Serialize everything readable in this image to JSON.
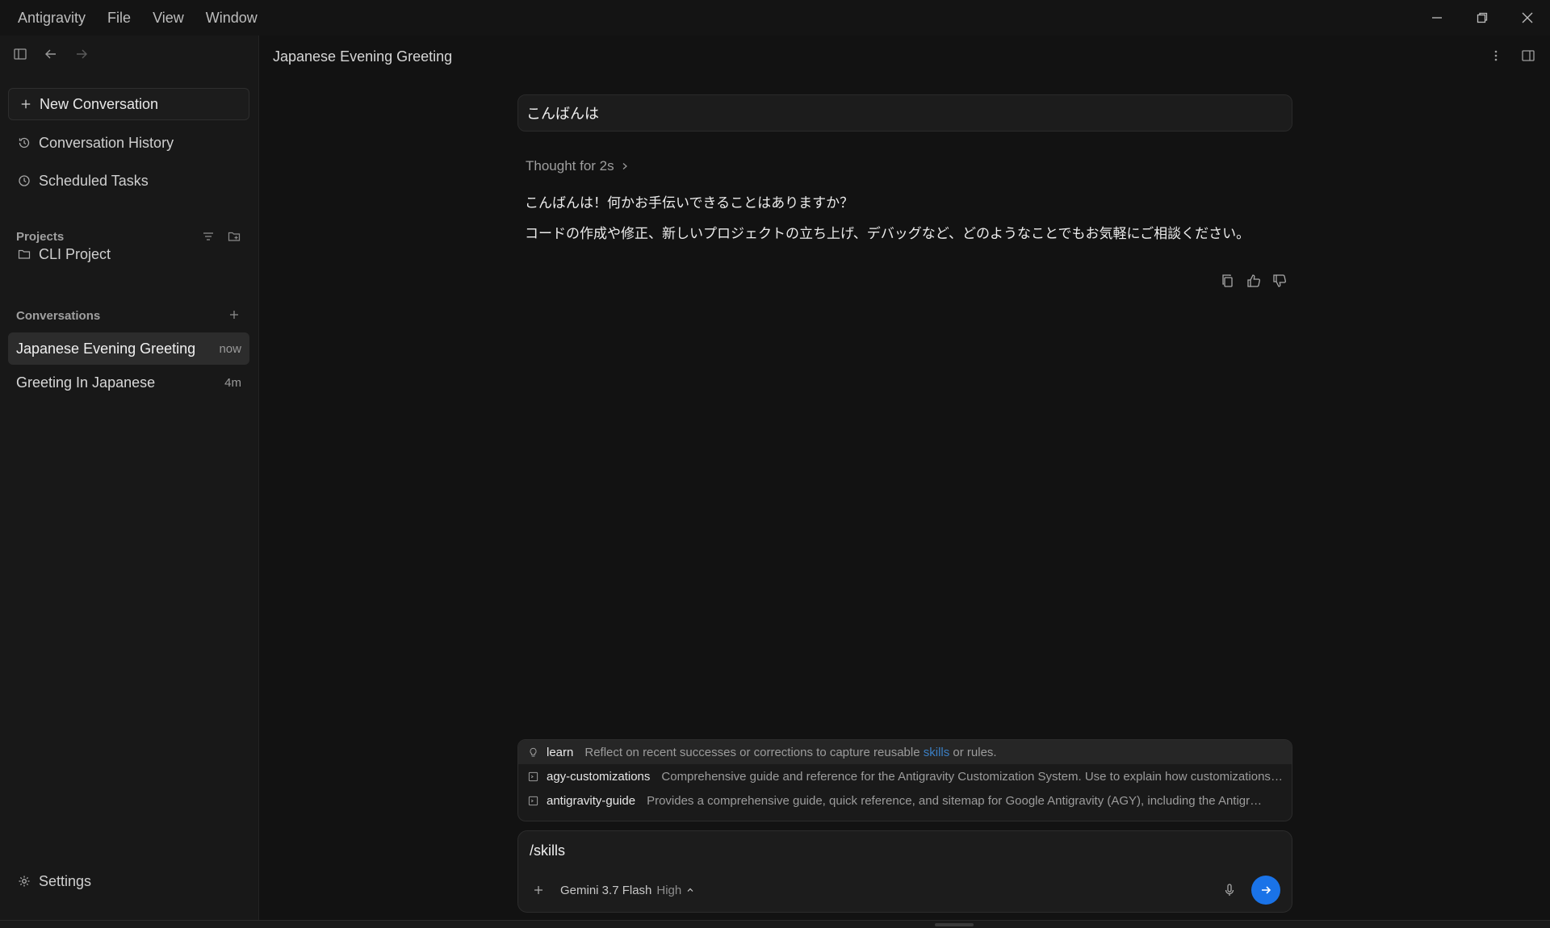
{
  "menu": [
    "Antigravity",
    "File",
    "View",
    "Window"
  ],
  "sidebar": {
    "new_conversation": "New Conversation",
    "history": "Conversation History",
    "scheduled": "Scheduled Tasks",
    "projects_label": "Projects",
    "project_name": "CLI Project",
    "conversations_label": "Conversations",
    "conversations": [
      {
        "title": "Japanese Evening Greeting",
        "time": "now"
      },
      {
        "title": "Greeting In Japanese",
        "time": "4m"
      }
    ],
    "settings": "Settings"
  },
  "main": {
    "title": "Japanese Evening Greeting",
    "user_message": "こんばんは",
    "thought": "Thought for 2s",
    "reply_lines": [
      "こんばんは！何かお手伝いできることはありますか？",
      "コードの作成や修正、新しいプロジェクトの立ち上げ、デバッグなど、どのようなことでもお気軽にご相談ください。"
    ]
  },
  "suggestions": [
    {
      "name": "learn",
      "desc_pre": "Reflect on recent successes or corrections to capture reusable ",
      "desc_link": "skills",
      "desc_post": " or rules.",
      "icon": "lightbulb-icon"
    },
    {
      "name": "agy-customizations",
      "desc": "Comprehensive guide and reference for the Antigravity Customization System. Use to explain how customizations ...",
      "icon": "skill-icon"
    },
    {
      "name": "antigravity-guide",
      "desc": "Provides a comprehensive guide, quick reference, and sitemap for Google Antigravity (AGY), including the Antigravity...",
      "icon": "skill-icon"
    }
  ],
  "input": {
    "value": "/skills",
    "model": "Gemini 3.7 Flash",
    "mode": "High"
  },
  "colors": {
    "accent": "#1a73e8",
    "link": "#3b7fc4"
  }
}
